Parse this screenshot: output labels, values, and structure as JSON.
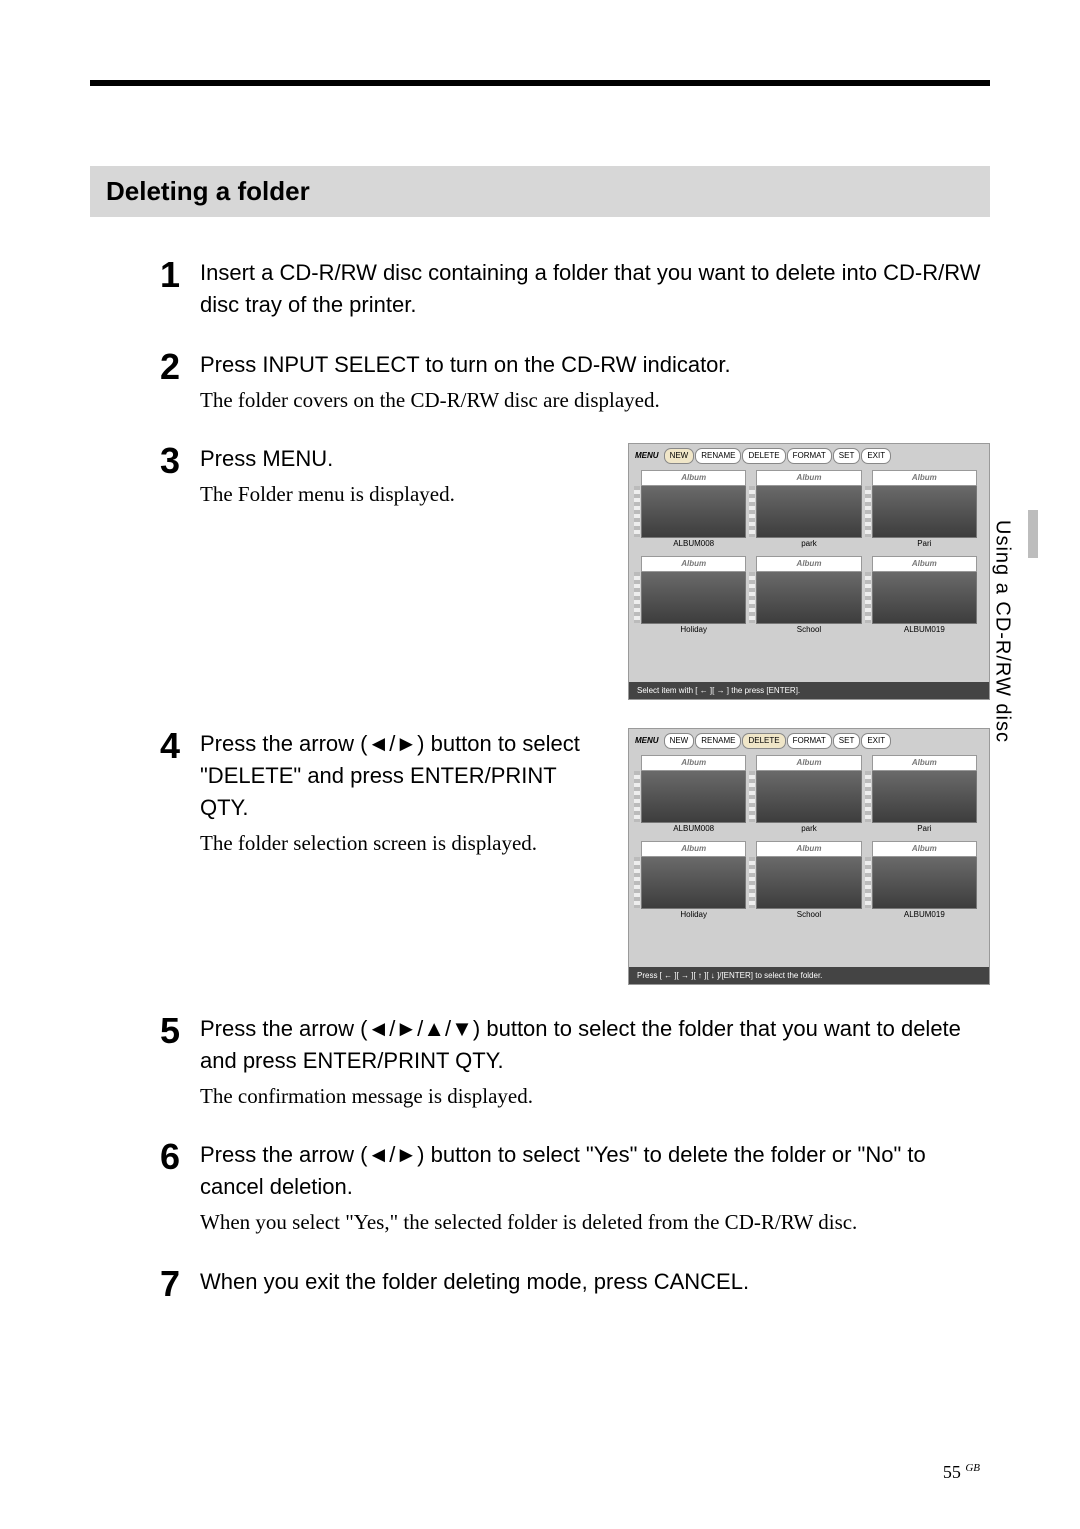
{
  "sectionTitle": "Deleting a folder",
  "sideTab": "Using a CD-R/RW disc",
  "pageNumber": "55",
  "pageSuffix": "GB",
  "steps": {
    "s1": {
      "num": "1",
      "main": "Insert a CD-R/RW disc containing a folder that you want to delete into CD-R/RW disc tray of the printer."
    },
    "s2": {
      "num": "2",
      "main": "Press INPUT SELECT to turn on the CD-RW indicator.",
      "sub": "The folder covers on the CD-R/RW disc are displayed."
    },
    "s3": {
      "num": "3",
      "main": "Press MENU.",
      "sub": "The Folder menu is displayed."
    },
    "s4": {
      "num": "4",
      "main": "Press the arrow  (◄/►) button to select \"DELETE\" and press ENTER/PRINT QTY.",
      "sub": "The folder selection screen is displayed."
    },
    "s5": {
      "num": "5",
      "main": "Press the arrow  (◄/►/▲/▼) button to select the folder that you want to delete and press ENTER/PRINT QTY.",
      "sub": "The confirmation message is displayed."
    },
    "s6": {
      "num": "6",
      "main": "Press the arrow (◄/►) button to select \"Yes\" to delete the folder or \"No\" to cancel deletion.",
      "sub": "When you select \"Yes,\" the selected folder is deleted from the CD-R/RW disc."
    },
    "s7": {
      "num": "7",
      "main": "When you exit the folder deleting mode, press CANCEL."
    }
  },
  "screenshot": {
    "menuLabel": "MENU",
    "tabs": {
      "new": "NEW",
      "rename": "RENAME",
      "delete": "DELETE",
      "format": "FORMAT",
      "set": "SET",
      "exit": "EXIT"
    },
    "thumbTop": "Album",
    "labels": {
      "a": "ALBUM008",
      "b": "park",
      "c": "Pari",
      "d": "Holiday",
      "e": "School",
      "f": "ALBUM019"
    },
    "footer1": "Select item with [ ← ][ → ] the press [ENTER].",
    "footer2": "Press [ ← ][ → ][ ↑ ][ ↓ ]/[ENTER] to select the folder."
  }
}
